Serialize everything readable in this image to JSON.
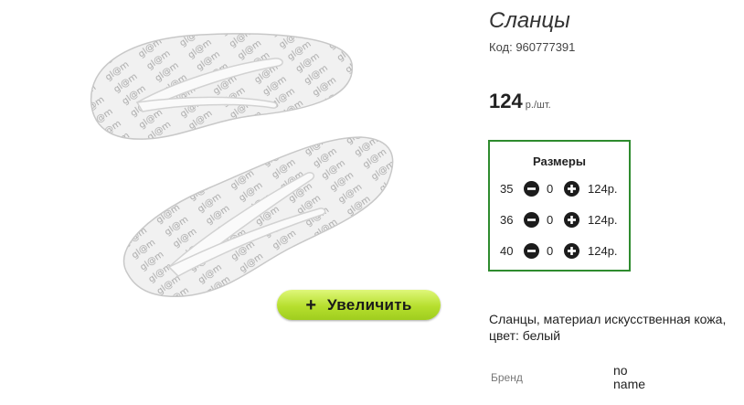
{
  "product": {
    "title": "Сланцы",
    "code": "Код: 960777391",
    "price": "124",
    "price_unit": " р./шт."
  },
  "zoom_button": {
    "icon": "+",
    "label": "Увеличить"
  },
  "sizes": {
    "header": "Размеры",
    "rows": [
      {
        "size": "35",
        "qty": "0",
        "price": "124р."
      },
      {
        "size": "36",
        "qty": "0",
        "price": "124р."
      },
      {
        "size": "40",
        "qty": "0",
        "price": "124р."
      }
    ]
  },
  "description": "Сланцы, материал искусственная кожа, цвет: белый",
  "brand": {
    "label": "Бренд",
    "value": "no name"
  },
  "colors": {
    "frame_green": "#2e8b2e",
    "button_lime": "#b6df2e"
  }
}
